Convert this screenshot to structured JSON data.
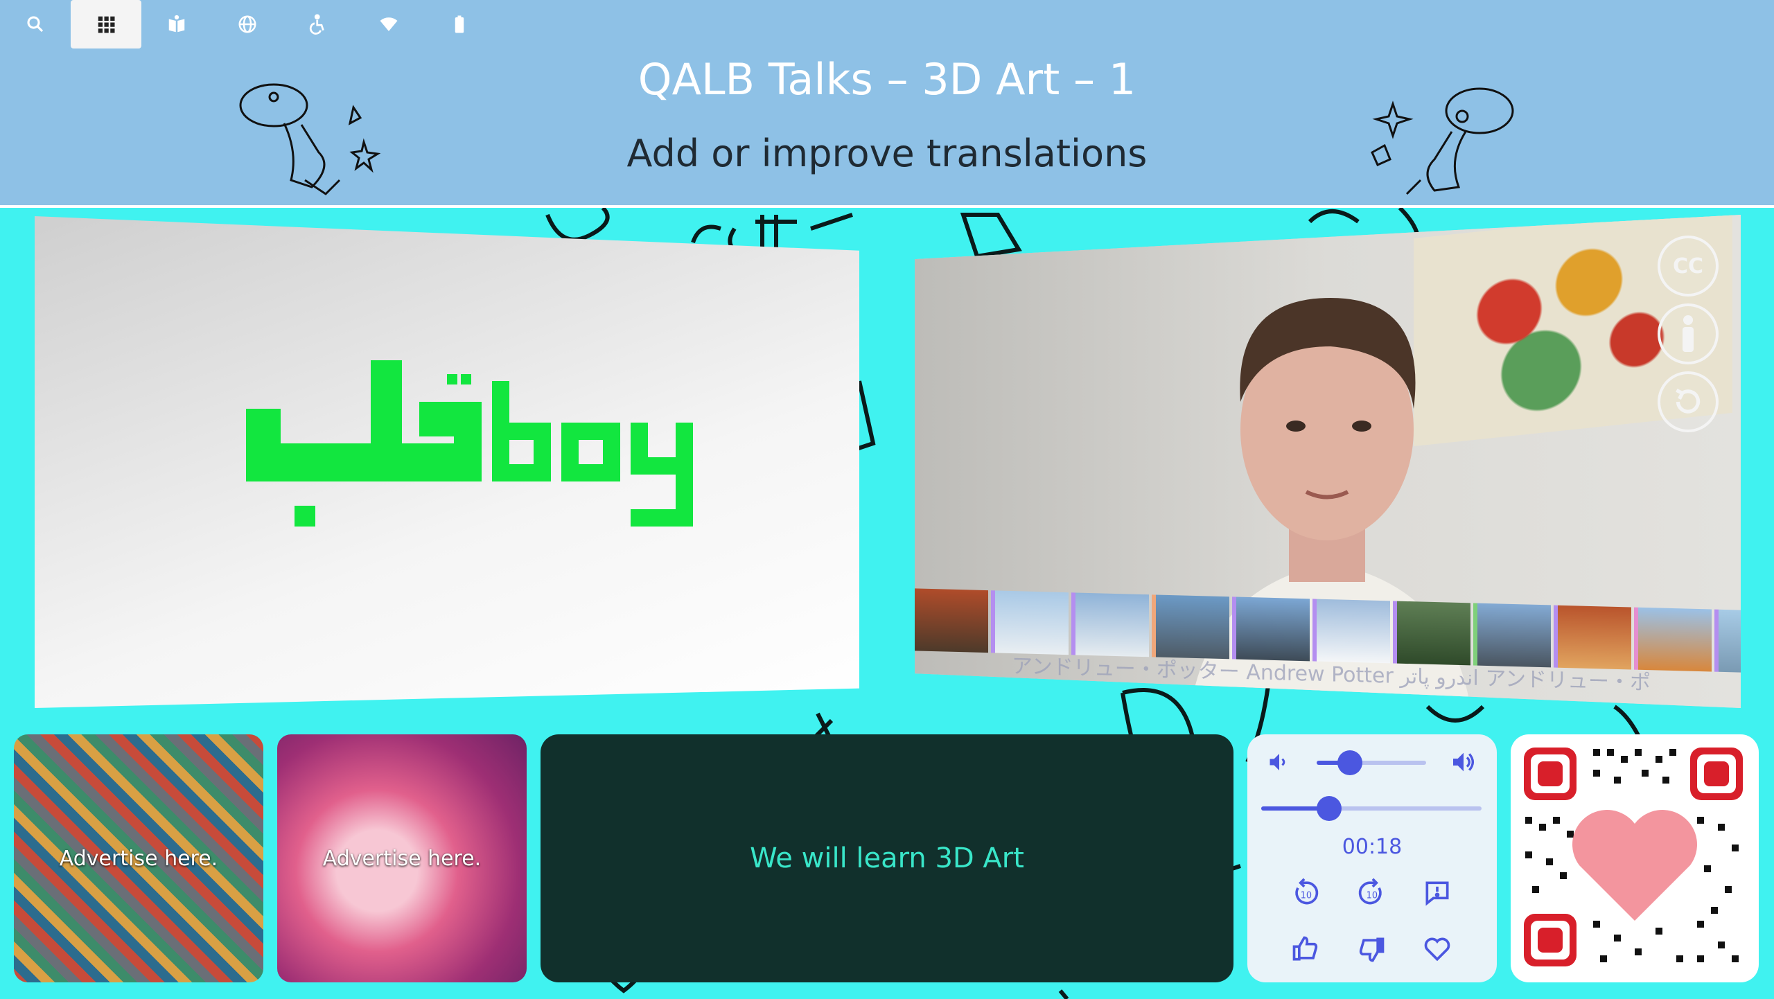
{
  "toolbar": {
    "items": [
      {
        "icon": "search-icon",
        "active": false
      },
      {
        "icon": "grid-icon",
        "active": true
      },
      {
        "icon": "book-icon",
        "active": false
      },
      {
        "icon": "globe-icon",
        "active": false
      },
      {
        "icon": "accessibility-icon",
        "active": false
      },
      {
        "icon": "wifi-icon",
        "active": false
      },
      {
        "icon": "battery-icon",
        "active": false
      }
    ]
  },
  "header": {
    "title": "QALB Talks – 3D Art – 1",
    "subtitle": "Add or improve translations"
  },
  "slide": {
    "logo_text": "قلب boy",
    "logo_color": "#12e63f"
  },
  "video": {
    "credits": "アンドリュー・ポッター  Andrew Potter  اندرو پاتر  アンドリュー・ポ",
    "buttons": [
      {
        "icon": "cc-icon",
        "label": "CC"
      },
      {
        "icon": "person-icon",
        "label": ""
      },
      {
        "icon": "replay-icon",
        "label": ""
      }
    ]
  },
  "ads": [
    {
      "label": "Advertise here."
    },
    {
      "label": "Advertise here."
    }
  ],
  "caption": {
    "text": "We will learn 3D Art"
  },
  "player": {
    "volume_level": 0.3,
    "progress_level": 0.3,
    "time": "00:18",
    "accent": "#4b57e0"
  },
  "colors": {
    "background": "#40f2f0",
    "header_bg": "#8ec1e6",
    "caption_bg": "#11302c",
    "caption_text": "#39e6c9",
    "qr_accent": "#d81f2a"
  }
}
